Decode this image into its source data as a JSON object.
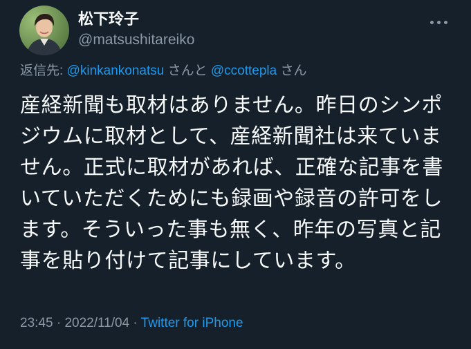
{
  "author": {
    "display_name": "松下玲子",
    "handle": "@matsushitareiko",
    "avatar_icon": "profile-photo"
  },
  "more_icon": "more-horizontal-icon",
  "reply": {
    "prefix": "返信先: ",
    "mention_1": "@kinkankonatsu",
    "mention_1_suffix": " さんと ",
    "mention_2": "@ccottepla",
    "mention_2_suffix": " さん"
  },
  "tweet": {
    "lines": [
      "産経新聞も取材はありません。昨日のシンポ",
      "ジウムに取材として、産経新聞社は来ていま",
      "せん。正式に取材があれば、正確な記事を書",
      "いていただくためにも録画や録音の許可をし",
      "ます。そういった事も無く、昨年の写真と記",
      "事を貼り付けて記事にしています。"
    ]
  },
  "meta": {
    "time": "23:45",
    "separator_1": " · ",
    "date": "2022/11/04",
    "separator_2": " · ",
    "source": "Twitter for iPhone"
  },
  "colors": {
    "background": "#15202b",
    "primary_text": "#f7f9f9",
    "secondary_text": "#8b98a5",
    "link": "#1d9bf0"
  }
}
